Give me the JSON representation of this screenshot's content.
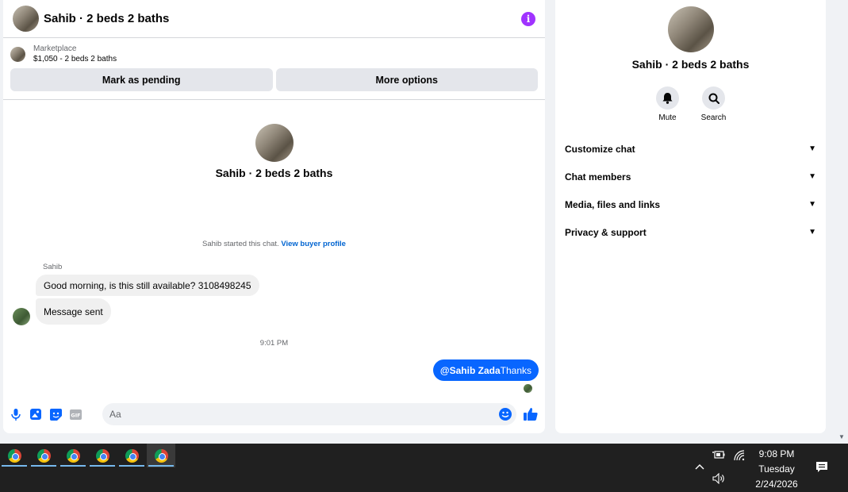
{
  "chat": {
    "title": "Sahib · 2 beds 2 baths",
    "info_icon": "info-icon",
    "listing": {
      "label": "Marketplace",
      "price": "$1,050 - 2 beds 2 baths",
      "pending_button": "Mark as pending",
      "more_button": "More options"
    },
    "intro_title": "Sahib · 2 beds 2 baths",
    "system_text": "Sahib started this chat.",
    "system_link": "View buyer profile",
    "sender_name": "Sahib",
    "messages": [
      "Good morning, is this still available? 3108498245",
      "Message sent"
    ],
    "timestamp": "9:01 PM",
    "outgoing": {
      "mention": "@Sahib Zada",
      "text": "Thanks"
    },
    "composer_placeholder": "Aa"
  },
  "info": {
    "title": "Sahib · 2 beds 2 baths",
    "actions": [
      {
        "label": "Mute",
        "icon": "bell-icon"
      },
      {
        "label": "Search",
        "icon": "search-icon"
      }
    ],
    "sections": [
      "Customize chat",
      "Chat members",
      "Media, files and links",
      "Privacy & support"
    ]
  },
  "taskbar": {
    "time": "9:08 PM",
    "day": "Tuesday",
    "date": "2/24/2026"
  },
  "colors": {
    "accent": "#0866ff",
    "info": "#a033ff"
  }
}
